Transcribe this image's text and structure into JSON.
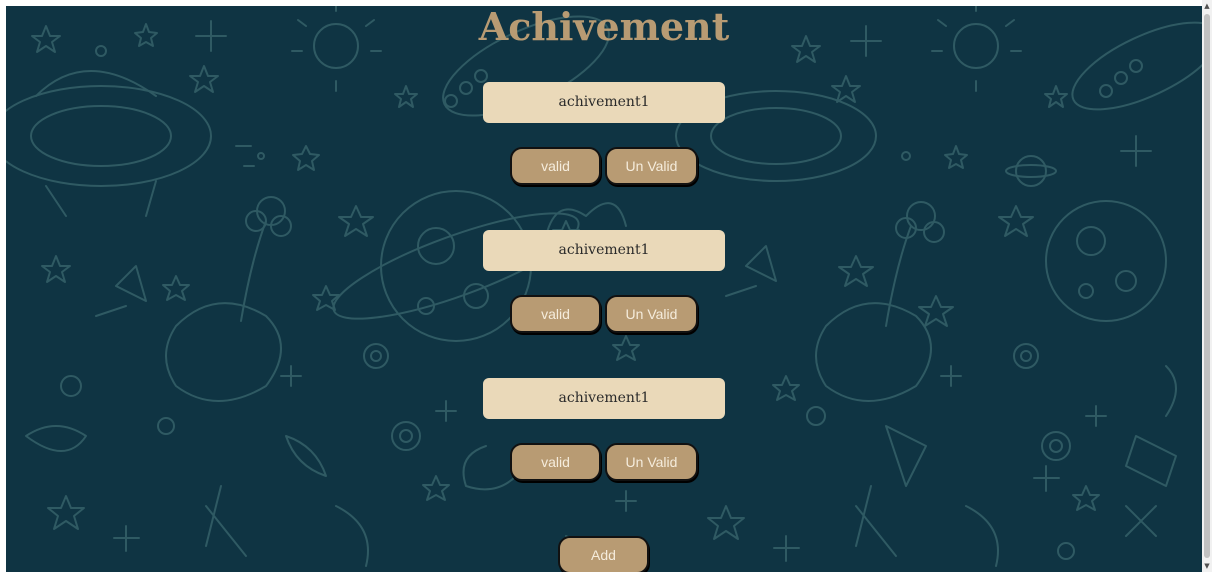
{
  "page": {
    "title": "Achivement",
    "background_color": "#0f3443",
    "accent_color": "#b89b73",
    "field_color": "#ead9b9"
  },
  "achievements": [
    {
      "name": "achivement1",
      "valid_label": "valid",
      "unvalid_label": "Un Valid"
    },
    {
      "name": "achivement1",
      "valid_label": "valid",
      "unvalid_label": "Un Valid"
    },
    {
      "name": "achivement1",
      "valid_label": "valid",
      "unvalid_label": "Un Valid"
    }
  ],
  "add_label": "Add",
  "scrollbar": {
    "up_icon": "triangle-up-icon",
    "down_icon": "triangle-down-icon"
  }
}
